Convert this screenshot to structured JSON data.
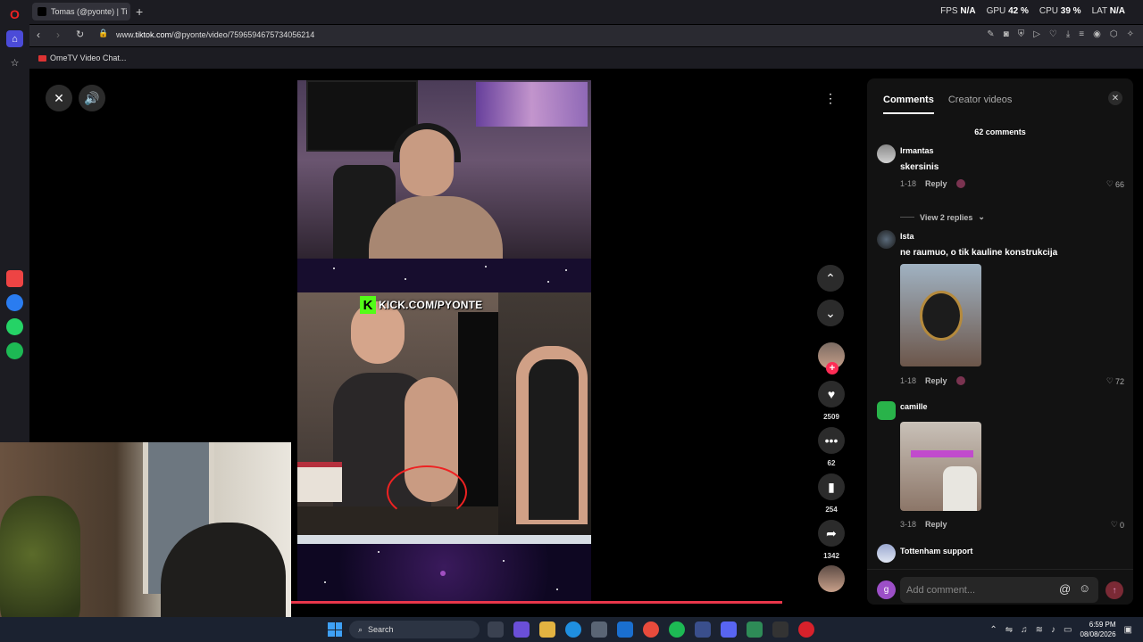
{
  "browser": {
    "tab_title": "Tomas (@pyonte) | Ti",
    "new_tab_symbol": "+",
    "url_prefix": "www.",
    "url_host": "tiktok.com",
    "url_path": "/@pyonte/video/7596594675734056214",
    "bookmark_label": "OmeTV Video Chat..."
  },
  "stats": {
    "fps_label": "FPS",
    "fps_value": "N/A",
    "gpu_label": "GPU",
    "gpu_value": "42 %",
    "cpu_label": "CPU",
    "cpu_value": "39 %",
    "lat_label": "LAT",
    "lat_value": "N/A"
  },
  "video": {
    "overlay_text": "KICK.COM/PYONTE",
    "kick_letter": "K",
    "progress_fraction": 1.0
  },
  "actions": {
    "likes": "2509",
    "comments": "62",
    "saves": "254",
    "shares": "1342"
  },
  "panel": {
    "tab_comments": "Comments",
    "tab_creator": "Creator videos",
    "comment_count": "62 comments",
    "input_placeholder": "Add comment...",
    "user_initial": "g"
  },
  "comments": [
    {
      "user": "Irmantas",
      "text": "skersinis",
      "date": "1-18",
      "reply": "Reply",
      "likes": "66"
    },
    {
      "user": "Ista",
      "text": "ne raumuo, o tik kauline konstrukcija",
      "date": "1-18",
      "reply": "Reply",
      "likes": "72"
    },
    {
      "user": "camille",
      "text": "",
      "date": "3-18",
      "reply": "Reply",
      "likes": "0"
    },
    {
      "user": "Tottenham support",
      "text": "",
      "date": "",
      "reply": "",
      "likes": ""
    }
  ],
  "view_replies": "View 2 replies",
  "taskbar": {
    "search_label": "Search",
    "time": "6:59 PM",
    "date": "08/08/2026"
  },
  "colors": {
    "accent_red": "#fe2c55",
    "kick_green": "#53fc18",
    "progress": "#e9364a"
  }
}
